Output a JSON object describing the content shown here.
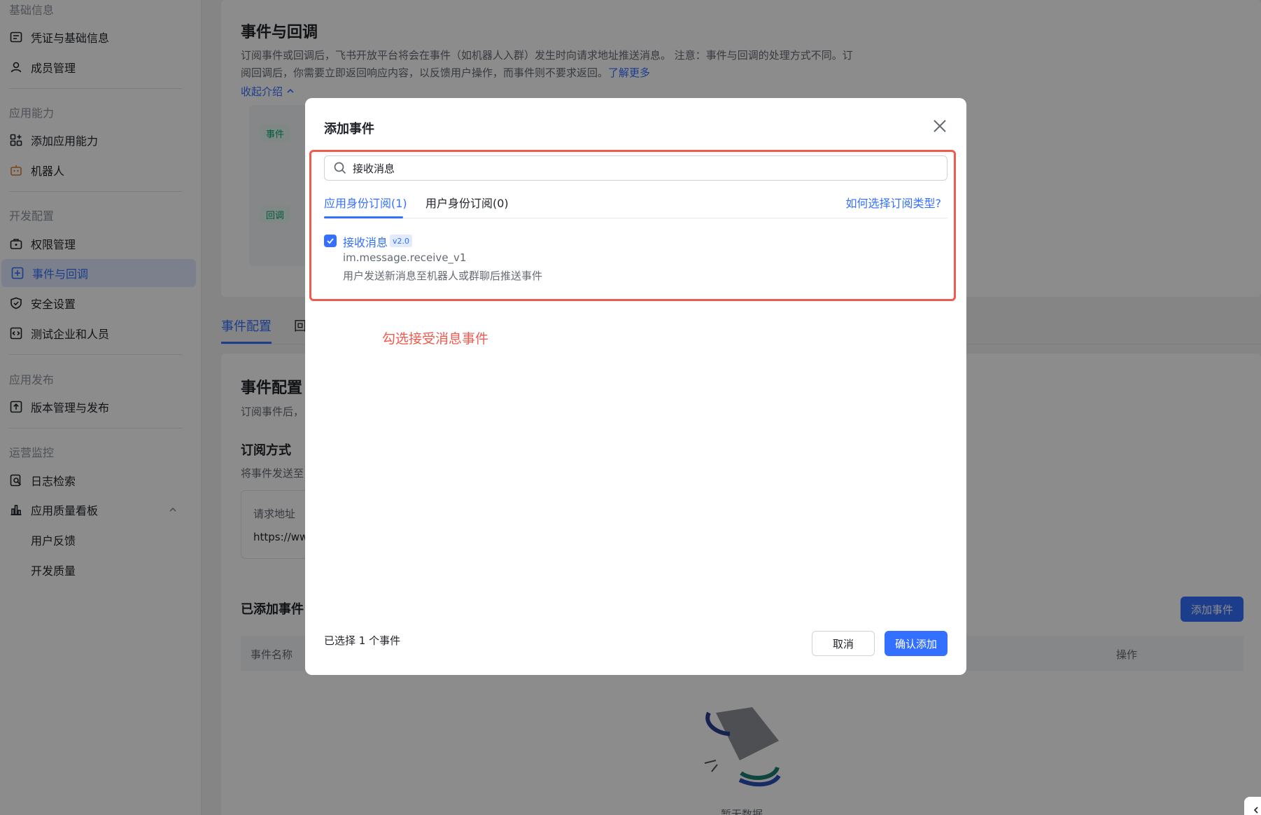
{
  "sidebar": {
    "sections": {
      "basic": "基础信息",
      "ability": "应用能力",
      "dev": "开发配置",
      "publish": "应用发布",
      "ops": "运营监控"
    },
    "items": {
      "credentials": "凭证与基础信息",
      "members": "成员管理",
      "add_ability": "添加应用能力",
      "robot": "机器人",
      "permissions": "权限管理",
      "events": "事件与回调",
      "security": "安全设置",
      "test_org": "测试企业和人员",
      "version": "版本管理与发布",
      "logs": "日志检索",
      "quality_board": "应用质量看板",
      "feedback": "用户反馈",
      "dev_quality": "开发质量"
    }
  },
  "page": {
    "title": "事件与回调",
    "desc": "订阅事件或回调后，飞书开放平台将会在事件（如机器人入群）发生时向请求地址推送消息。 注意：事件与回调的处理方式不同。订阅回调后，你需要立即返回响应内容，以反馈用户操作，而事件则不要求返回。",
    "learn_more": "了解更多",
    "collapse": "收起介绍",
    "tag_event": "事件",
    "tag_callback": "回调",
    "tab_event_config": "事件配置",
    "tab_other": "回",
    "section_title": "事件配置",
    "section_desc": "订阅事件后，",
    "subscribe_mode": "订阅方式",
    "subscribe_desc": "将事件发送至",
    "req_url_label": "请求地址",
    "req_url_val": "https://ww",
    "added_events": "已添加事件",
    "add_event_btn": "添加事件",
    "col_name": "事件名称",
    "col_ops": "操作",
    "empty": "暂无数据"
  },
  "modal": {
    "title": "添加事件",
    "search_value": "接收消息",
    "tab_app": "应用身份订阅(1)",
    "tab_user": "用户身份订阅(0)",
    "help": "如何选择订阅类型?",
    "event_name": "接收消息",
    "event_version": "v2.0",
    "event_key": "im.message.receive_v1",
    "event_desc": "用户发送新消息至机器人或群聊后推送事件",
    "annotation": "勾选接受消息事件",
    "selected_count": "已选择 1 个事件",
    "cancel": "取消",
    "confirm": "确认添加"
  },
  "colors": {
    "accent": "#3370ff",
    "annotation": "#f05a4f"
  }
}
